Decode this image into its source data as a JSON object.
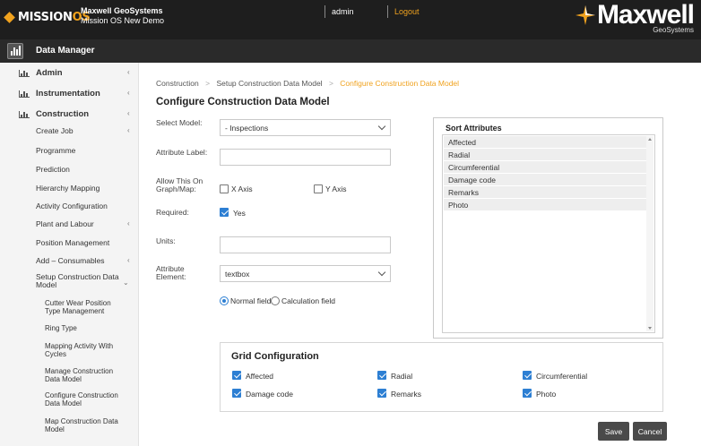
{
  "header": {
    "logo_main": "MISSION",
    "logo_accent": "OS",
    "org_name": "Maxwell GeoSystems",
    "org_sub": "Mission OS New Demo",
    "user": "admin",
    "logout": "Logout",
    "brand_name": "Maxwell",
    "brand_sub": "GeoSystems",
    "accent_color": "#f0a21e"
  },
  "module": {
    "title": "Data Manager"
  },
  "sidebar": {
    "top": [
      {
        "label": "Admin",
        "chev": "‹"
      },
      {
        "label": "Instrumentation",
        "chev": "‹"
      },
      {
        "label": "Construction",
        "chev": "‹"
      }
    ],
    "sub": [
      {
        "label": "Create Job",
        "chev": "‹"
      },
      {
        "label": "Programme",
        "chev": ""
      },
      {
        "label": "Prediction",
        "chev": ""
      },
      {
        "label": "Hierarchy Mapping",
        "chev": ""
      },
      {
        "label": "Activity Configuration",
        "chev": ""
      },
      {
        "label": "Plant and Labour",
        "chev": "‹"
      },
      {
        "label": "Position Management",
        "chev": ""
      },
      {
        "label": "Add – Consumables",
        "chev": "‹"
      },
      {
        "label": "Setup Construction Data Model",
        "chev": "⌄"
      }
    ],
    "sub2": [
      {
        "label": "Cutter Wear Position Type Management"
      },
      {
        "label": "Ring Type"
      },
      {
        "label": "Mapping Activity With Cycles"
      },
      {
        "label": "Manage Construction Data Model"
      },
      {
        "label": "Configure Construction Data Model"
      },
      {
        "label": "Map Construction Data Model"
      }
    ]
  },
  "breadcrumb": {
    "items": [
      "Construction",
      "Setup Construction Data Model",
      "Configure Construction Data Model"
    ],
    "separator": ">"
  },
  "page_title": "Configure Construction Data Model",
  "form": {
    "select_model_label": "Select Model:",
    "select_model_value": "- Inspections",
    "attribute_label_label": "Attribute Label:",
    "attribute_label_value": "",
    "allow_graph_label": "Allow This On Graph/Map:",
    "x_axis_label": "X Axis",
    "x_axis_checked": false,
    "y_axis_label": "Y Axis",
    "y_axis_checked": false,
    "required_label": "Required:",
    "required_value_label": "Yes",
    "required_checked": true,
    "units_label": "Units:",
    "units_value": "",
    "attribute_element_label": "Attribute Element:",
    "attribute_element_value": "textbox",
    "normal_field_label": "Normal field",
    "calculation_field_label": "Calculation field",
    "normal_field_selected": true
  },
  "sort_attributes": {
    "title": "Sort Attributes",
    "items": [
      "Affected",
      "Radial",
      "Circumferential",
      "Damage code",
      "Remarks",
      "Photo"
    ]
  },
  "grid_config": {
    "title": "Grid Configuration",
    "items": [
      {
        "label": "Affected",
        "checked": true
      },
      {
        "label": "Radial",
        "checked": true
      },
      {
        "label": "Circumferential",
        "checked": true
      },
      {
        "label": "Damage code",
        "checked": true
      },
      {
        "label": "Remarks",
        "checked": true
      },
      {
        "label": "Photo",
        "checked": true
      }
    ]
  },
  "actions": {
    "save_label": "Save",
    "cancel_label": "Cancel"
  }
}
